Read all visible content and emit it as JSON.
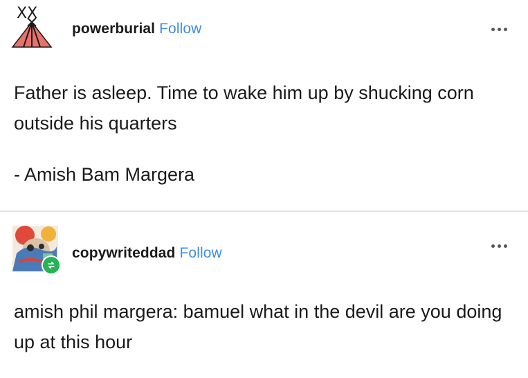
{
  "post1": {
    "username": "powerburial",
    "follow_label": "Follow",
    "avatar_text": "XX",
    "avatar_color": "#e8726a",
    "text": "Father is asleep. Time to wake him up by shucking corn outside his quarters",
    "attribution": "- Amish Bam Margera",
    "more_icon": "ellipsis-icon"
  },
  "post2": {
    "username": "copywriteddad",
    "follow_label": "Follow",
    "text": "amish phil margera: bamuel what in the devil are you doing up at this hour",
    "badge_icon": "reblog-icon",
    "badge_color": "#22b455",
    "more_icon": "ellipsis-icon"
  },
  "colors": {
    "follow": "#3d8fe0",
    "text": "#1a1a1a",
    "divider": "#e3e3e3"
  }
}
